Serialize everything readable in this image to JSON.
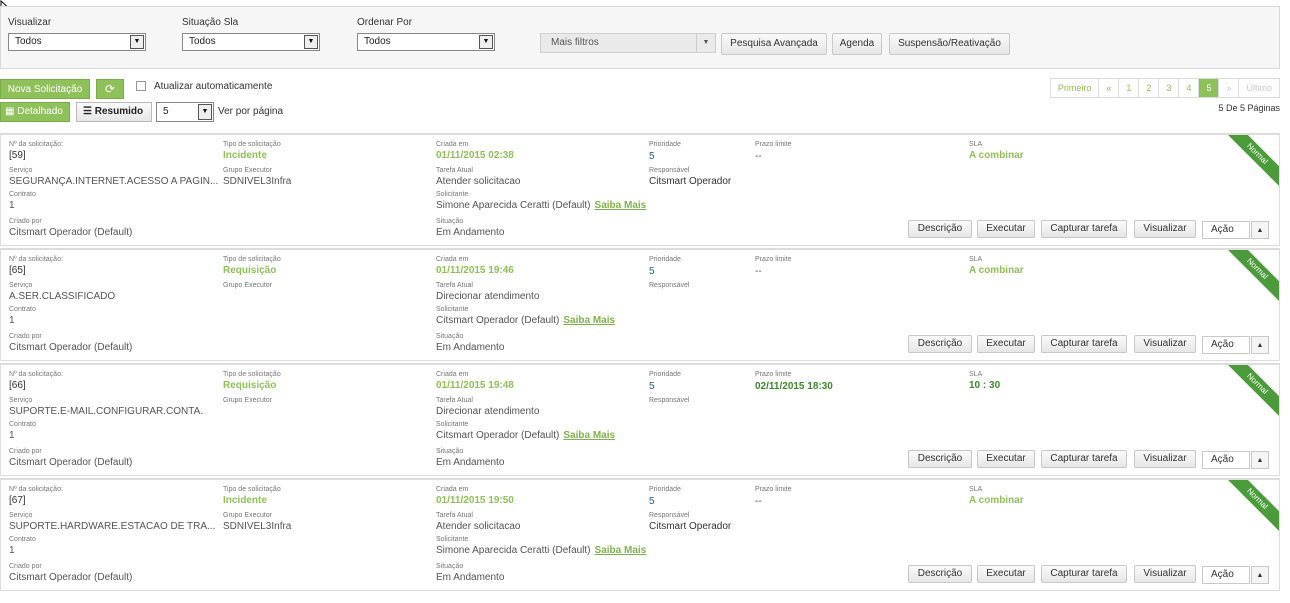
{
  "filters": {
    "visualizar": {
      "label": "Visualizar",
      "value": "Todos"
    },
    "situacao": {
      "label": "Situação Sla",
      "value": "Todos"
    },
    "ordenar": {
      "label": "Ordenar Por",
      "value": "Todos"
    },
    "mais_filtros": "Mais filtros",
    "pesquisa": "Pesquisa Avançada",
    "agenda": "Agenda",
    "suspensao": "Suspensão/Reativação"
  },
  "toolbar": {
    "nova": "Nova Solicitação",
    "atualizar": "Atualizar automaticamente",
    "detalhado": "Detalhado",
    "resumido": "Resumido",
    "per_page": "5",
    "ver_por_pagina": "Ver por página"
  },
  "pager": {
    "primeiro": "Primeiro",
    "prev": "«",
    "pages": [
      "1",
      "2",
      "3",
      "4",
      "5"
    ],
    "next": "»",
    "ultimo": "Último",
    "info": "5 De 5 Páginas"
  },
  "labels": {
    "numero": "Nº da solicitação:",
    "tipo": "Tipo de solicitação",
    "criada": "Criada em",
    "prioridade": "Prioridade",
    "prazo": "Prazo limite",
    "sla": "SLA",
    "servico": "Serviço",
    "grupo": "Grupo Executor",
    "tarefa": "Tarefa Atual",
    "responsavel": "Responsável",
    "contrato": "Contrato",
    "solicitante": "Solicitante",
    "criado_por": "Criado por",
    "situacao": "Situação",
    "saiba": "Saiba Mais",
    "ribbon": "Normal"
  },
  "buttons": {
    "descricao": "Descrição",
    "executar": "Executar",
    "capturar": "Capturar tarefa",
    "visualizar": "Visualizar",
    "acao": "Ação"
  },
  "requests": [
    {
      "numero": "[59]",
      "tipo": "Incidente",
      "criada": "01/11/2015 02:38",
      "prioridade": "5",
      "prazo": "--",
      "sla": "A combinar",
      "servico": "SEGURANÇA.INTERNET.ACESSO A PAGIN...",
      "grupo": "SDNIVEL3Infra",
      "tarefa": "Atender solicitacao",
      "responsavel": "Citsmart Operador",
      "contrato": "1",
      "solicitante": "Simone Aparecida Ceratti (Default)",
      "criado_por": "Citsmart Operador (Default)",
      "situacao": "Em Andamento"
    },
    {
      "numero": "[65]",
      "tipo": "Requisição",
      "criada": "01/11/2015 19:46",
      "prioridade": "5",
      "prazo": "--",
      "sla": "A combinar",
      "servico": "A.SER.CLASSIFICADO",
      "grupo": "",
      "tarefa": "Direcionar atendimento",
      "responsavel": "",
      "contrato": "1",
      "solicitante": "Citsmart Operador (Default)",
      "criado_por": "Citsmart Operador (Default)",
      "situacao": "Em Andamento"
    },
    {
      "numero": "[66]",
      "tipo": "Requisição",
      "criada": "01/11/2015 19:48",
      "prioridade": "5",
      "prazo": "02/11/2015 18:30",
      "sla": "10 : 30",
      "servico": "SUPORTE.E-MAIL.CONFIGURAR.CONTA.",
      "grupo": "",
      "tarefa": "Direcionar atendimento",
      "responsavel": "",
      "contrato": "1",
      "solicitante": "Citsmart Operador (Default)",
      "criado_por": "Citsmart Operador (Default)",
      "situacao": "Em Andamento"
    },
    {
      "numero": "[67]",
      "tipo": "Incidente",
      "criada": "01/11/2015 19:50",
      "prioridade": "5",
      "prazo": "--",
      "sla": "A combinar",
      "servico": "SUPORTE.HARDWARE.ESTACAO DE TRA...",
      "grupo": "SDNIVEL3Infra",
      "tarefa": "Atender solicitacao",
      "responsavel": "Citsmart Operador",
      "contrato": "1",
      "solicitante": "Simone Aparecida Ceratti (Default)",
      "criado_por": "Citsmart Operador (Default)",
      "situacao": "Em Andamento"
    }
  ]
}
